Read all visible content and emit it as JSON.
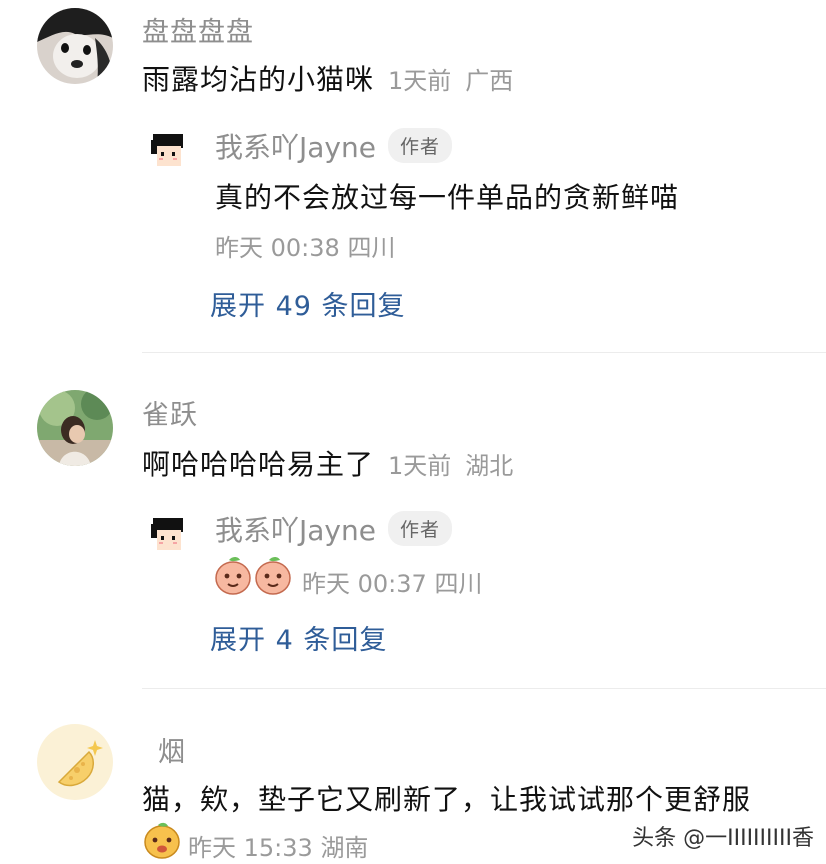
{
  "comments": [
    {
      "username": "盘盘盘盘",
      "text": "雨露均沾的小猫咪",
      "time": "1天前",
      "location": "广西",
      "reply": {
        "username": "我系吖Jayne",
        "badge": "作者",
        "text": "真的不会放过每一件单品的贪新鲜喵",
        "time": "昨天 00:38",
        "location": "四川"
      },
      "expand_label": "展开 49 条回复"
    },
    {
      "username": "雀跃",
      "text": "啊哈哈哈哈易主了",
      "time": "1天前",
      "location": "湖北",
      "reply": {
        "username": "我系吖Jayne",
        "badge": "作者",
        "emoji": [
          "peach-emoji",
          "peach-emoji"
        ],
        "time": "昨天 00:37",
        "location": "四川"
      },
      "expand_label": "展开 4 条回复"
    },
    {
      "username": "烟",
      "text": "猫，欸，垫子它又刷新了，让我试试那个更舒服",
      "emoji": "face-emoji",
      "time": "昨天 15:33",
      "location": "湖南"
    }
  ],
  "watermark": "头条 @一IIIIIIIIII香",
  "colors": {
    "link": "#2f5d98",
    "meta": "#9a9a9a",
    "badge_bg": "#f0f0f0"
  }
}
